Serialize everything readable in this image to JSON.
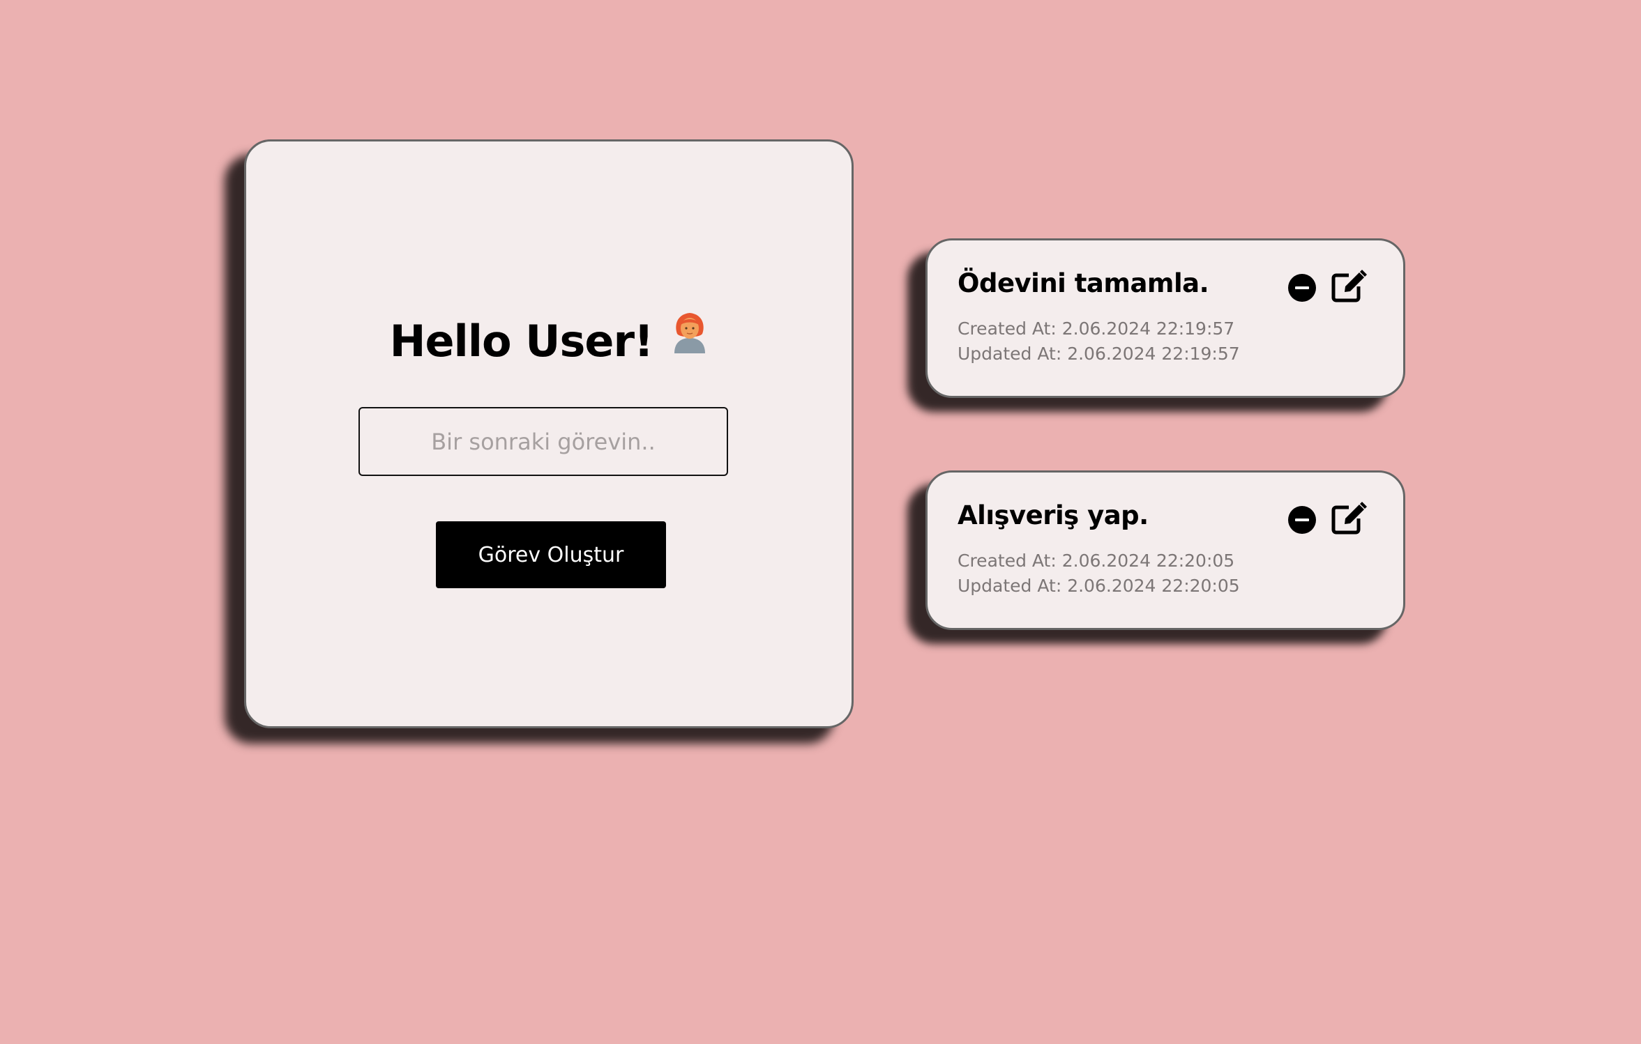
{
  "greeting": {
    "title": "Hello User!",
    "avatar_icon": "woman-red-hair-icon"
  },
  "task_form": {
    "input_value": "",
    "input_placeholder": "Bir sonraki görevin..",
    "create_button_label": "Görev Oluştur"
  },
  "tasks": [
    {
      "title": "Ödevini tamamla.",
      "created_label": "Created At: ",
      "created_value": "2.06.2024 22:19:57",
      "updated_label": "Updated At: ",
      "updated_value": "2.06.2024 22:19:57",
      "delete_icon": "minus-circle-icon",
      "edit_icon": "edit-pencil-icon"
    },
    {
      "title": "Alışveriş yap.",
      "created_label": "Created At: ",
      "created_value": "2.06.2024 22:20:05",
      "updated_label": "Updated At: ",
      "updated_value": "2.06.2024 22:20:05",
      "delete_icon": "minus-circle-icon",
      "edit_icon": "edit-pencil-icon"
    }
  ],
  "colors": {
    "background": "#ebb1b1",
    "card": "#f4eded",
    "button": "#000000",
    "button_text": "#ffffff",
    "meta_text": "#7c7676"
  }
}
